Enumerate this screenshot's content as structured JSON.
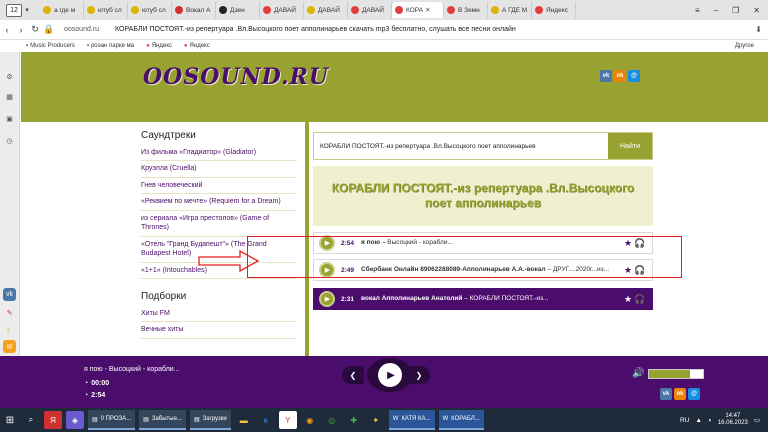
{
  "browser": {
    "tab_counter": "12",
    "tabs": [
      {
        "label": "а где м",
        "color": "#e0b400"
      },
      {
        "label": "ютуб сл",
        "color": "#e0b400"
      },
      {
        "label": "ютуб сл",
        "color": "#e0b400"
      },
      {
        "label": "Вокал А",
        "color": "#d03030"
      },
      {
        "label": "Дзен",
        "color": "#222222"
      },
      {
        "label": "ДАВАЙ",
        "color": "#e04040"
      },
      {
        "label": "ДАВАЙ",
        "color": "#e0b400"
      },
      {
        "label": "ДАВАЙ",
        "color": "#e04040"
      },
      {
        "label": "КОРА",
        "color": "#e04040",
        "active": true
      },
      {
        "label": "В Земн",
        "color": "#e04040"
      },
      {
        "label": "А ГДЕ М",
        "color": "#e0b400"
      },
      {
        "label": "Яндекс",
        "color": "#e04040"
      }
    ],
    "url_domain": "oosound.ru",
    "page_title": "КОРАБЛИ ПОСТОЯТ.-из репертуара .Вл.Высоцкого поет апполинарьев скачать mp3 бесплатно, слушать все песни онлайн",
    "bookmarks": [
      "Music Producers",
      "роэан парке ма",
      "Яндекс",
      "Яндекс"
    ],
    "bookmarks_other": "Другое"
  },
  "site": {
    "logo": "OOSOUND.RU",
    "sidebar": {
      "heading": "Саундтреки",
      "items": [
        "Из фильма «Гладиатор» (Gladiator)",
        "Круэлла (Cruella)",
        "Гнев человеческий",
        "«Реквием по мечте» (Requiem for a Dream)",
        "из сериала «Игра престолов» (Game of Thrones)",
        "«Отель \"Гранд Будапешт\"» (The Grand Budapest Hotel)",
        "«1+1» (Intouchables)"
      ],
      "heading2": "Подборки",
      "items2": [
        "Хиты FM",
        "Вечные хиты"
      ]
    },
    "search": {
      "value": "КОРАБЛИ ПОСТОЯТ.-из репертуара .Вл.Высоцкого поет апполинарьев",
      "button": "Найти"
    },
    "headline": "КОРАБЛИ ПОСТОЯТ.-из репертуара .Вл.Высоцкого поет апполинарьев",
    "tracks": [
      {
        "duration": "2:54",
        "artist": "я пою",
        "title": "Высоцкий - корабли..."
      },
      {
        "duration": "2:49",
        "artist": "Сбербанк Онлайн 89062288089-Апполинарьев А.А.-вокал",
        "title": "ДРУГ....2020г...из..."
      },
      {
        "duration": "2:31",
        "artist": "вокал Апполинарьев Анатолий",
        "title": "КОРАБЛИ ПОСТОЯТ.-из..."
      }
    ]
  },
  "player": {
    "title": "я пою - Высоцкий - корабли...",
    "elapsed": "00:00",
    "total": "2:54",
    "volume": 0.75
  },
  "taskbar": {
    "tasks": [
      "0 ПРОЗА...",
      "Забытые...",
      "Загрузки"
    ],
    "lang": "RU",
    "time": "14:47",
    "date": "16.06.2023",
    "word_tasks": [
      "КАТЯ КА...",
      "КОРАБЛ..."
    ]
  },
  "colors": {
    "olive": "#98a231",
    "purple": "#4b0d6b"
  }
}
